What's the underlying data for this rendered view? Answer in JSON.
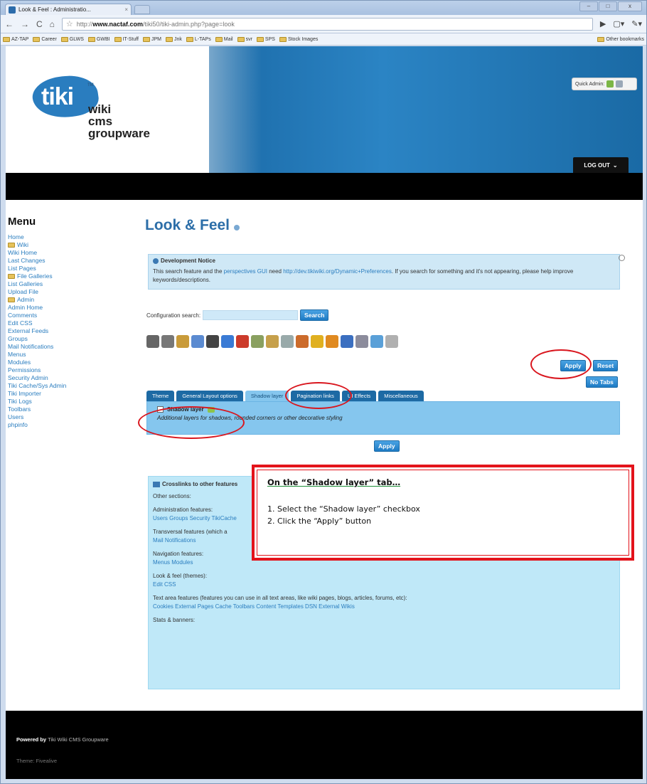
{
  "browser": {
    "tab_title": "Look & Feel : Administratio...",
    "tab_close": "×",
    "url_prefix": "http://",
    "url_host": "www.nactaf.com",
    "url_path": "/tiki50/tiki-admin.php?page=look",
    "window_controls": [
      "–",
      "□",
      "x"
    ],
    "bookmarks": [
      "AZ-TAP",
      "Career",
      "GLWS",
      "GWBI",
      "IT-Stuff",
      "JPM",
      "Jnk",
      "L-TAPs",
      "Mail",
      "svr",
      "SPS",
      "Stock Images"
    ],
    "other_bookmarks": "Other bookmarks"
  },
  "header": {
    "logo_word": "tiki",
    "logo_tm": "TM",
    "logo_sub1": "wiki",
    "logo_sub2": "cms",
    "logo_sub3": "groupware",
    "quick_admin": "Quick Admin:",
    "logout_label": "LOG OUT"
  },
  "menu": {
    "title": "Menu",
    "items": [
      {
        "label": "Home",
        "folder": false
      },
      {
        "label": "Wiki",
        "folder": true
      },
      {
        "label": "Wiki Home",
        "folder": false
      },
      {
        "label": "Last Changes",
        "folder": false
      },
      {
        "label": "List Pages",
        "folder": false
      },
      {
        "label": "File Galleries",
        "folder": true
      },
      {
        "label": "List Galleries",
        "folder": false
      },
      {
        "label": "Upload File",
        "folder": false
      },
      {
        "label": "Admin",
        "folder": true
      },
      {
        "label": "Admin Home",
        "folder": false
      },
      {
        "label": "Comments",
        "folder": false
      },
      {
        "label": "Edit CSS",
        "folder": false
      },
      {
        "label": "External Feeds",
        "folder": false
      },
      {
        "label": "Groups",
        "folder": false
      },
      {
        "label": "Mail Notifications",
        "folder": false
      },
      {
        "label": "Menus",
        "folder": false
      },
      {
        "label": "Modules",
        "folder": false
      },
      {
        "label": "Permissions",
        "folder": false
      },
      {
        "label": "Security Admin",
        "folder": false
      },
      {
        "label": "Tiki Cache/Sys Admin",
        "folder": false
      },
      {
        "label": "Tiki Importer",
        "folder": false
      },
      {
        "label": "Tiki Logs",
        "folder": false
      },
      {
        "label": "Toolbars",
        "folder": false
      },
      {
        "label": "Users",
        "folder": false
      },
      {
        "label": "phpinfo",
        "folder": false
      }
    ]
  },
  "main": {
    "page_title": "Look & Feel",
    "notice_title": "Development Notice",
    "notice_text_1": "This search feature and the ",
    "notice_link_1": "perspectives GUI",
    "notice_text_2": " need ",
    "notice_link_2": "http://dev.tikiwiki.org/Dynamic+Preferences",
    "notice_text_3": ". If you search for something and it's not appearing, please help improve keywords/descriptions.",
    "config_search_label": "Configuration search:",
    "search_button": "Search",
    "apply_label": "Apply",
    "reset_label": "Reset",
    "notabs_label": "No Tabs",
    "tabs": [
      "Theme",
      "General Layout options",
      "Shadow layer",
      "Pagination links",
      "UI Effects",
      "Miscellaneous"
    ],
    "shadow_checkbox_label": "Shadow layer",
    "shadow_hint": "Additional layers for shadows, rounded corners or other decorative styling"
  },
  "crosslinks": {
    "title": "Crosslinks to other features",
    "other_sections": "Other sections:",
    "admin_features": "Administration features:",
    "admin_links": "Users Groups Security TikiCache",
    "transversal": "Transversal features (which a",
    "transversal_links": "Mail Notifications",
    "navigation": "Navigation features:",
    "navigation_links": "Menus Modules",
    "lookfeel": "Look & feel (themes):",
    "lookfeel_links": "Edit CSS",
    "textarea": "Text area features (features you can use in all text areas, like wiki pages, blogs, articles, forums, etc):",
    "textarea_links": "Cookies External Pages Cache Toolbars Content Templates DSN External Wikis",
    "stats": "Stats & banners:"
  },
  "callout": {
    "heading": "On the “Shadow layer” tab…",
    "step1": "1. Select the “Shadow layer” checkbox",
    "step2": "2. Click the “Apply” button"
  },
  "footer": {
    "powered_bold": "Powered by",
    "powered_rest": "Tiki Wiki CMS Groupware",
    "theme": "Theme: Fivealive"
  },
  "colors": {
    "tiki_blue": "#2c6ea8",
    "link_blue": "#2a7dbf",
    "callout_red": "#e3131b",
    "panel_blue": "#85c6ee"
  }
}
